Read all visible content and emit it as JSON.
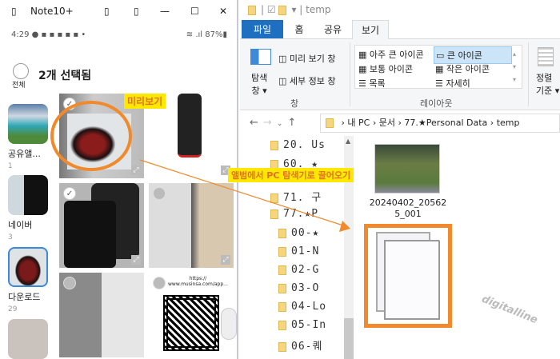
{
  "phone": {
    "title": "Note10+",
    "status_time": "4:29",
    "battery": "87%",
    "select_all": "전체",
    "header": "2개 선택됨",
    "albums": [
      {
        "name": "공유앨...",
        "count": "1"
      },
      {
        "name": "네이버",
        "count": "3"
      },
      {
        "name": "다운로드",
        "count": "29"
      }
    ],
    "qr_url": "https://\nwww.musinsa.com/app..."
  },
  "explorer": {
    "title": "temp",
    "tabs": [
      "파일",
      "홈",
      "공유",
      "보기"
    ],
    "ribbon": {
      "nav_pane": "탐색\n창 ▾",
      "preview_pane": "미리 보기 창",
      "details_pane": "세부 정보 창",
      "pane_group": "창",
      "layouts": [
        "아주 큰 아이콘",
        "큰 아이콘",
        "보통 아이콘",
        "작은 아이콘",
        "목록",
        "자세히"
      ],
      "layout_group": "레이아웃",
      "sort": "정렬\n기준 ▾"
    },
    "breadcrumb": [
      "내 PC",
      "문서",
      "77.★Personal Data",
      "temp"
    ],
    "nav_folders": [
      "20. Us",
      "60. ★",
      "71. 구",
      "77.★P",
      "00-★",
      "01-N",
      "02-G",
      "03-O",
      "04-Lo",
      "05-In",
      "06-퀘"
    ],
    "files": [
      {
        "name": "20240402_205625_001"
      }
    ]
  },
  "annotations": {
    "preview": "미리보기",
    "drag": "앨범에서 PC 탐색기로 끌어오기",
    "watermark": "digitalline"
  },
  "colors": {
    "accent": "#1e6fbf",
    "annotation": "#f08a2c",
    "label_bg": "#ffe800"
  }
}
